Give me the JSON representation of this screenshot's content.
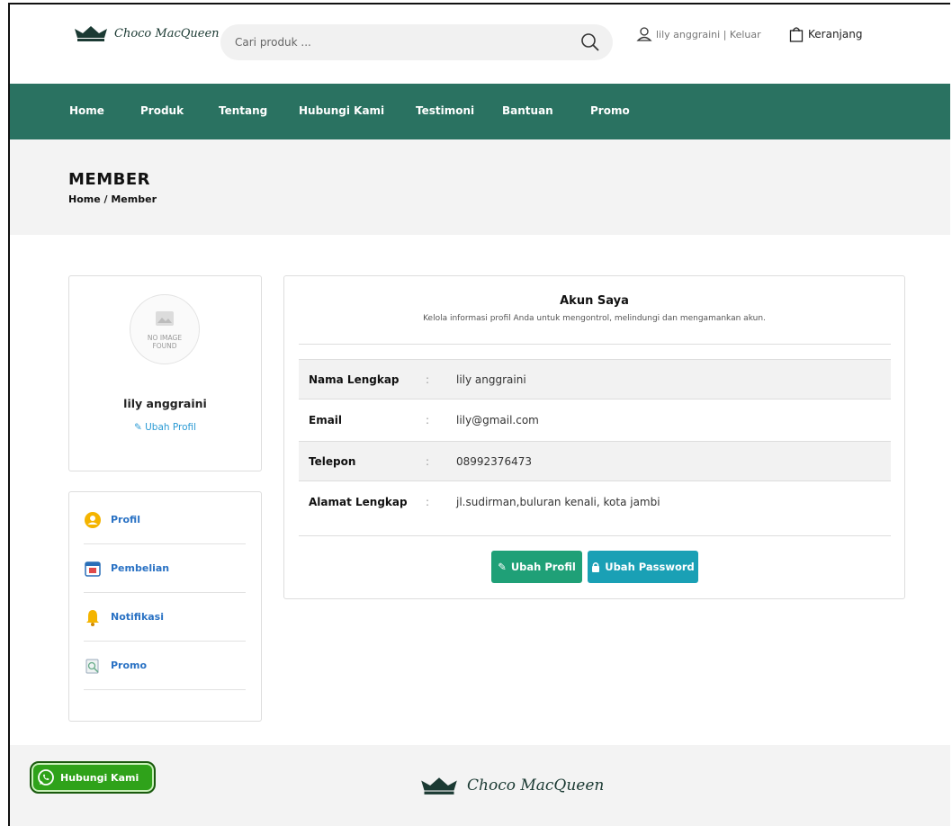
{
  "header": {
    "logo_text": "Choco MacQueen",
    "search_placeholder": "Cari produk ...",
    "user_text": "lily anggraini | Keluar",
    "cart_label": "Keranjang"
  },
  "nav": {
    "items": [
      "Home",
      "Produk",
      "Tentang",
      "Hubungi Kami",
      "Testimoni",
      "Bantuan",
      "Promo"
    ]
  },
  "page": {
    "title": "MEMBER",
    "breadcrumb": "Home / Member"
  },
  "profile_card": {
    "no_image_line1": "NO IMAGE",
    "no_image_line2": "FOUND",
    "name": "lily anggraini",
    "edit_label": "Ubah Profil"
  },
  "side_menu": {
    "items": [
      {
        "label": "Profil",
        "icon": "user-circle-icon"
      },
      {
        "label": "Pembelian",
        "icon": "calendar-icon"
      },
      {
        "label": "Notifikasi",
        "icon": "bell-icon"
      },
      {
        "label": "Promo",
        "icon": "promo-icon"
      }
    ]
  },
  "account": {
    "title": "Akun Saya",
    "subtitle": "Kelola informasi profil Anda untuk mengontrol, melindungi dan mengamankan akun.",
    "separator": ":",
    "fields": [
      {
        "label": "Nama Lengkap",
        "value": "lily anggraini"
      },
      {
        "label": "Email",
        "value": "lily@gmail.com"
      },
      {
        "label": "Telepon",
        "value": "08992376473"
      },
      {
        "label": "Alamat Lengkap",
        "value": "jl.sudirman,buluran kenali, kota jambi"
      }
    ],
    "edit_button": "Ubah Profil",
    "password_button": "Ubah Password"
  },
  "footer": {
    "whatsapp_label": "Hubungi Kami",
    "logo_text": "Choco MacQueen"
  },
  "colors": {
    "nav_bg": "#2a7261",
    "primary_button": "#1fa077",
    "info_button": "#1aa0b5",
    "link": "#2a72c4",
    "whatsapp": "#2fa21a"
  }
}
